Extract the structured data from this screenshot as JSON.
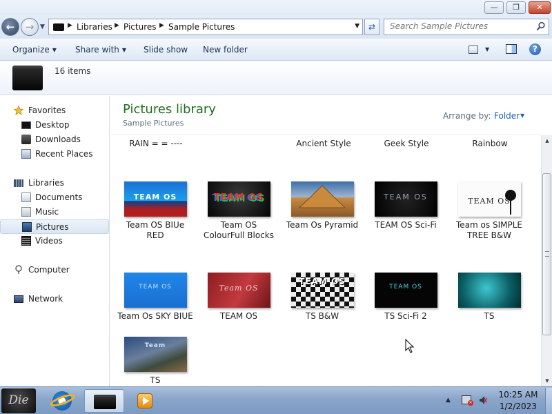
{
  "address": {
    "crumbs": [
      "Libraries",
      "Pictures",
      "Sample Pictures"
    ]
  },
  "search": {
    "placeholder": "Search Sample Pictures"
  },
  "toolbar": {
    "organize": "Organize",
    "share_with": "Share with",
    "slide_show": "Slide show",
    "new_folder": "New folder"
  },
  "details": {
    "item_count": "16 items"
  },
  "nav": {
    "favorites": "Favorites",
    "desktop": "Desktop",
    "downloads": "Downloads",
    "recent_places": "Recent Places",
    "libraries": "Libraries",
    "documents": "Documents",
    "music": "Music",
    "pictures": "Pictures",
    "videos": "Videos",
    "computer": "Computer",
    "network": "Network"
  },
  "content": {
    "title": "Pictures library",
    "subtitle": "Sample Pictures",
    "arrange_by_label": "Arrange by:",
    "arrange_by_value": "Folder",
    "partial_captions": [
      "RAIN = = ----",
      "Ancient Style",
      "Geek Style",
      "Rainbow"
    ],
    "row1": [
      {
        "caption": "Team OS BIUe RED",
        "thumb_text": "TEAM OS"
      },
      {
        "caption": "Team OS ColourFull Blocks",
        "thumb_text": "TEAM OS"
      },
      {
        "caption": "Team Os Pyramid",
        "thumb_text": ""
      },
      {
        "caption": "TEAM OS Sci-Fi",
        "thumb_text": "TEAM OS"
      },
      {
        "caption": "Team os SIMPLE TREE B&W",
        "thumb_text": "TEAM OS"
      }
    ],
    "row2": [
      {
        "caption": "Team Os SKY BIUE",
        "thumb_text": "TEAM OS"
      },
      {
        "caption": "TEAM OS",
        "thumb_text": "Team OS"
      },
      {
        "caption": "TS B&W",
        "thumb_text": "TEAM OS"
      },
      {
        "caption": "TS Sci-Fi 2",
        "thumb_text": "TEAM OS"
      },
      {
        "caption": "TS",
        "thumb_text": ""
      }
    ],
    "row3": [
      {
        "caption": "TS",
        "thumb_text": "Team"
      }
    ]
  },
  "taskbar": {
    "start_text": "Die",
    "ie_glyph": "e",
    "time": "10:25 AM",
    "date": "1/2/2023"
  }
}
